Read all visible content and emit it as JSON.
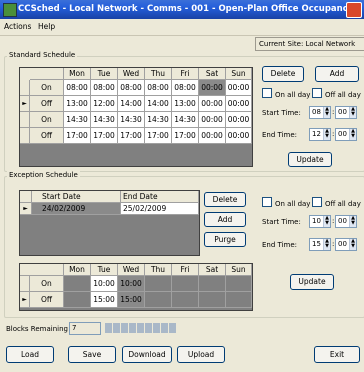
{
  "window": {
    "title": "CCSched - Local Network - Comms - 001 - Open-Plan Office Occupancy"
  },
  "menu": [
    "Actions",
    "Help"
  ],
  "site": {
    "label": "Current Site: Local Network"
  },
  "standard": {
    "title": "Standard Schedule",
    "days": [
      "Mon",
      "Tue",
      "Wed",
      "Thu",
      "Fri",
      "Sat",
      "Sun"
    ],
    "rows": [
      {
        "label": "On",
        "values": [
          "08:00",
          "08:00",
          "08:00",
          "08:00",
          "08:00",
          "00:00",
          "00:00"
        ]
      },
      {
        "label": "Off",
        "values": [
          "13:00",
          "12:00",
          "14:00",
          "14:00",
          "13:00",
          "00:00",
          "00:00"
        ]
      },
      {
        "label": "On",
        "values": [
          "14:30",
          "14:30",
          "14:30",
          "14:30",
          "14:30",
          "00:00",
          "00:00"
        ]
      },
      {
        "label": "Off",
        "values": [
          "17:00",
          "17:00",
          "17:00",
          "17:00",
          "17:00",
          "00:00",
          "00:00"
        ]
      }
    ],
    "delete": "Delete",
    "add": "Add",
    "on_all_day": "On all day",
    "off_all_day": "Off all day",
    "start_label": "Start Time:",
    "start_h": "08",
    "start_m": "00",
    "end_label": "End Time:",
    "end_h": "12",
    "end_m": "00",
    "update": "Update"
  },
  "exception": {
    "title": "Exception Schedule",
    "col_start": "Start Date",
    "col_end": "End Date",
    "start_date": "24/02/2009",
    "end_date": "25/02/2009",
    "delete": "Delete",
    "add": "Add",
    "purge": "Purge",
    "on_all_day": "On all day",
    "off_all_day": "Off all day",
    "start_label": "Start Time:",
    "start_h": "10",
    "start_m": "00",
    "end_label": "End Time:",
    "end_h": "15",
    "end_m": "00",
    "days": [
      "Mon",
      "Tue",
      "Wed",
      "Thu",
      "Fri",
      "Sat",
      "Sun"
    ],
    "rows": [
      {
        "label": "On",
        "values": [
          "",
          "10:00",
          "10:00",
          "",
          "",
          "",
          ""
        ]
      },
      {
        "label": "Off",
        "values": [
          "",
          "15:00",
          "15:00",
          "",
          "",
          "",
          ""
        ]
      }
    ],
    "update": "Update"
  },
  "blocks": {
    "label": "Blocks Remaining",
    "value": "7"
  },
  "buttons": {
    "load": "Load",
    "save": "Save",
    "download": "Download",
    "upload": "Upload",
    "exit": "Exit"
  },
  "colors": {
    "title_bar": "#245edb",
    "grid_bg": "#808080"
  }
}
